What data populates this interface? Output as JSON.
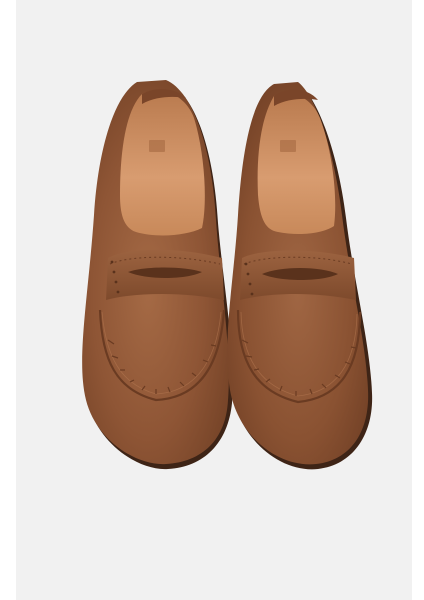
{
  "product_image": {
    "alt": "",
    "colors": {
      "backdrop": "#f1f1f1",
      "page_margin": "#ffffff",
      "suede_main": "#8a5232",
      "suede_light": "#a56a45",
      "suede_dark": "#6a3b22",
      "lining": "#c8895a",
      "lining_light": "#dca27a",
      "sole_edge": "#3e2416"
    },
    "item_count": 2
  }
}
